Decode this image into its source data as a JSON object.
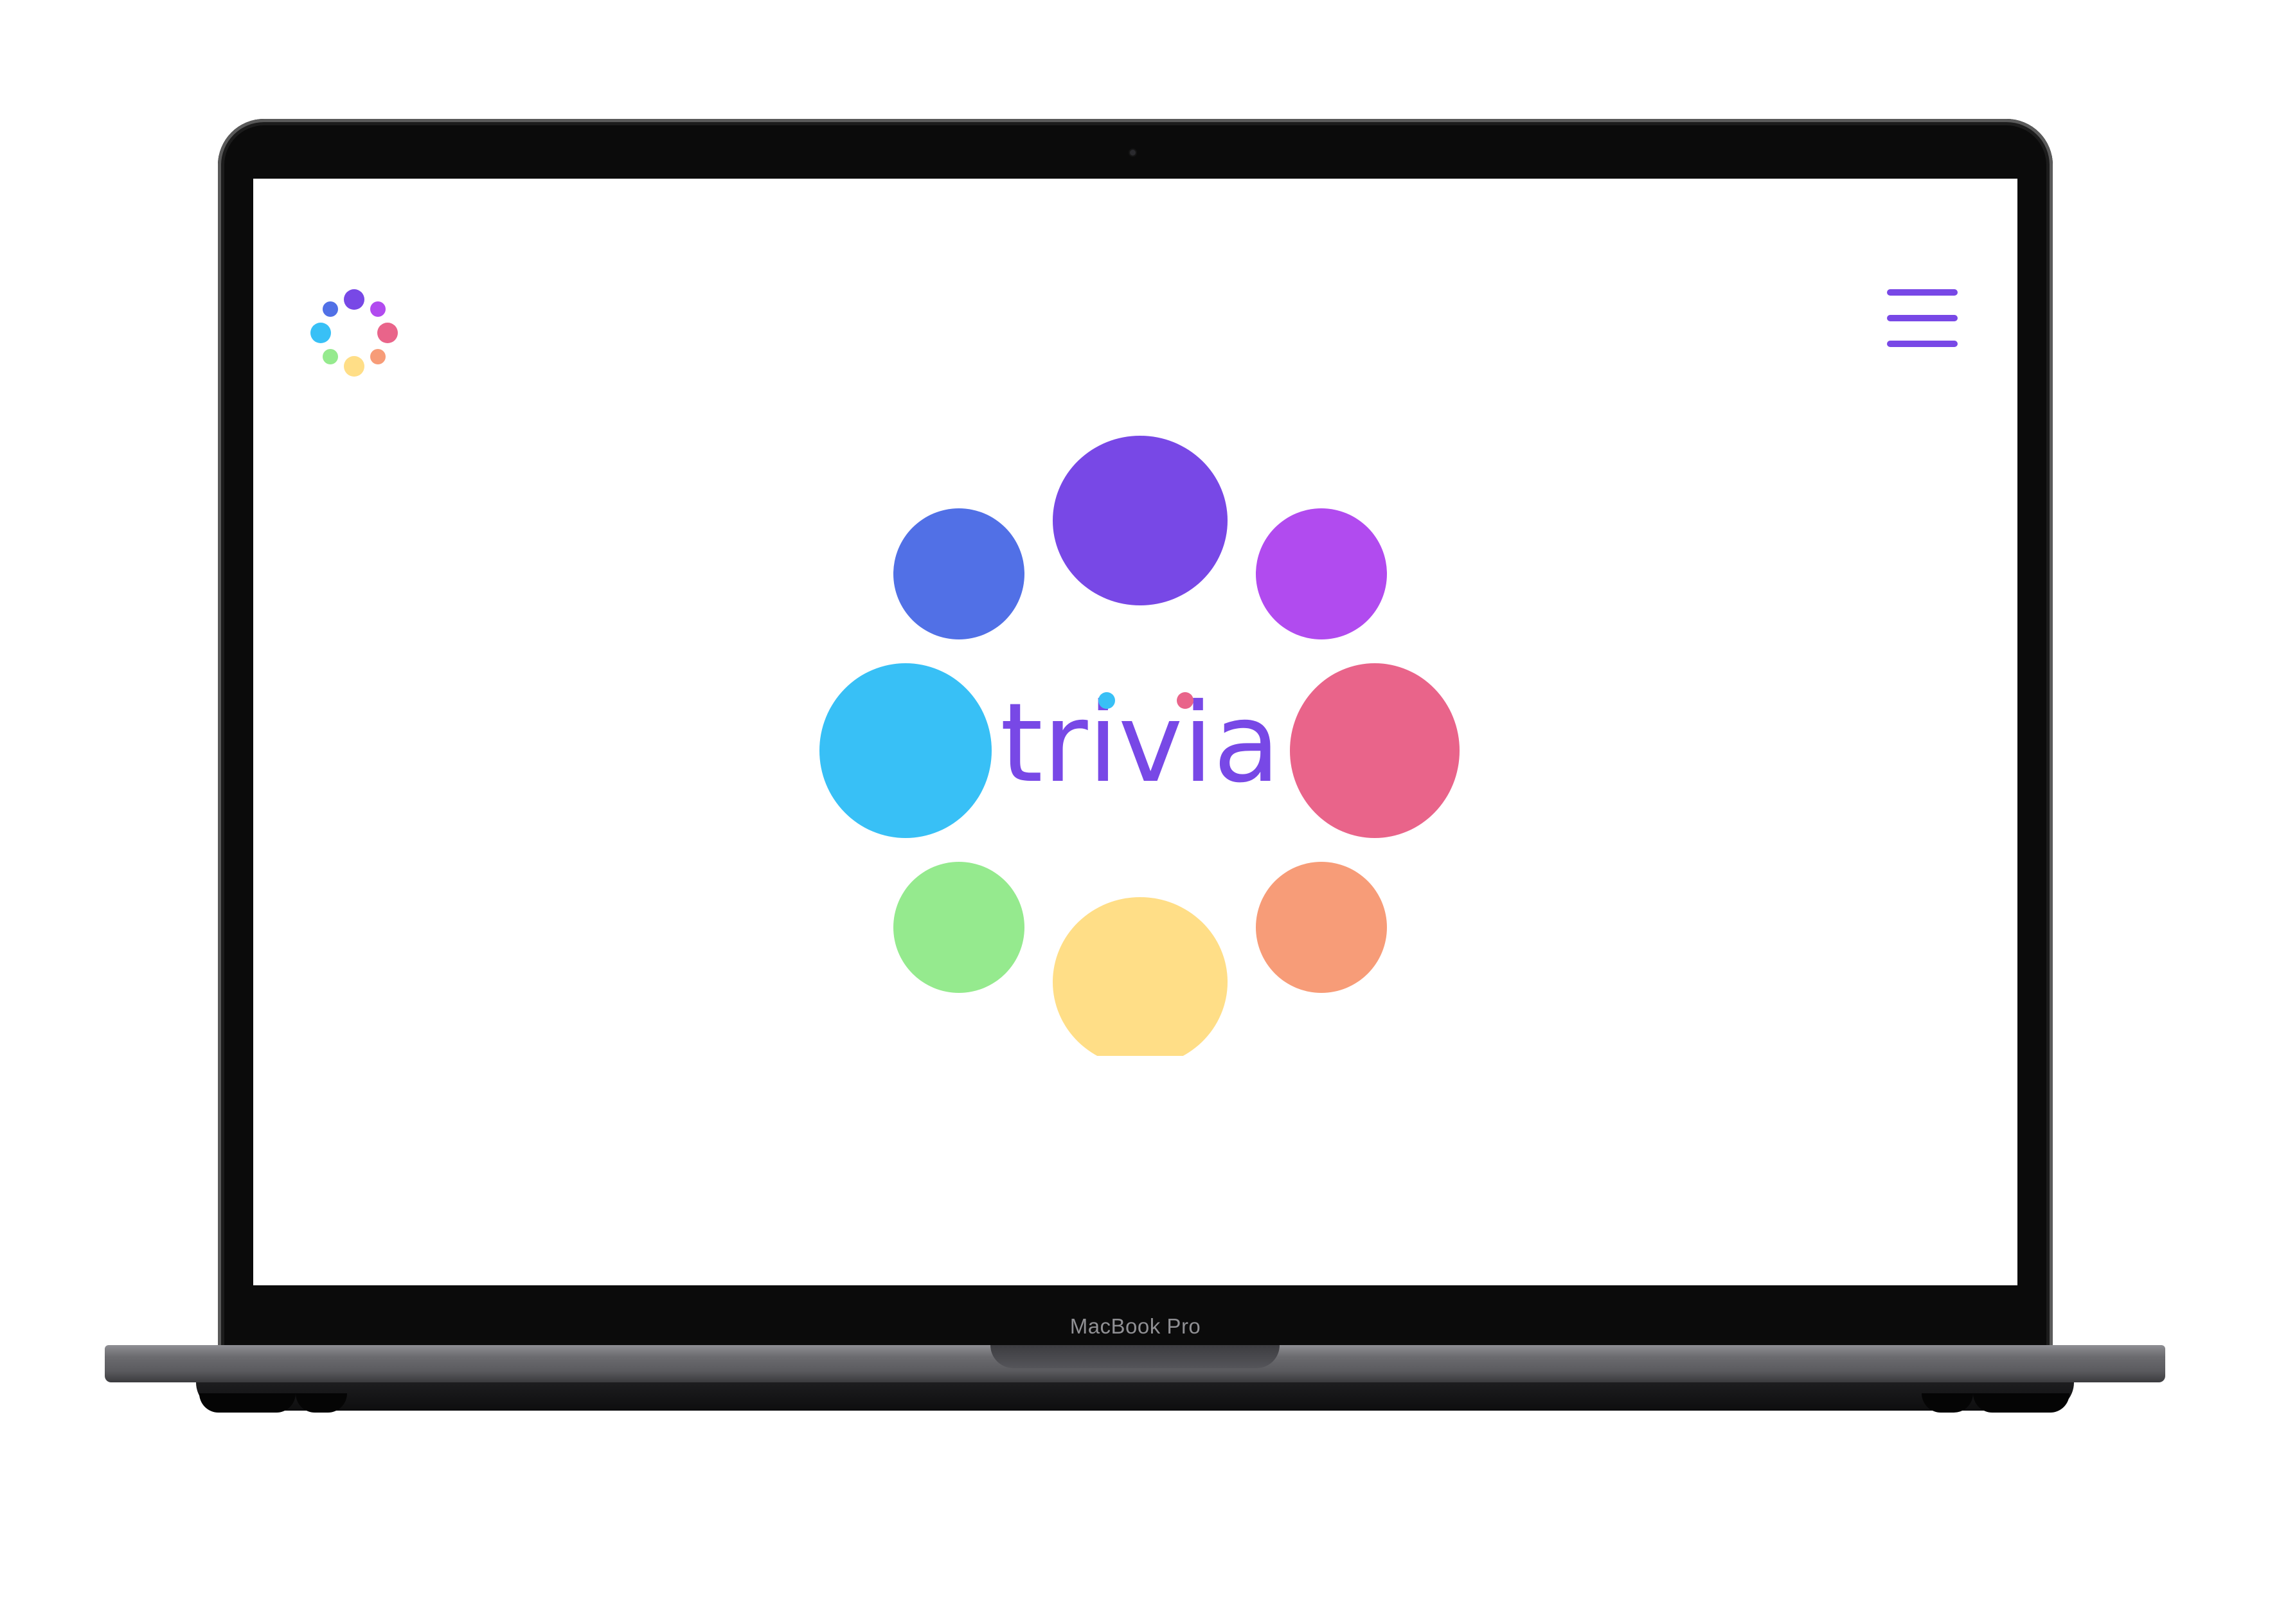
{
  "device": {
    "label": "MacBook Pro"
  },
  "app": {
    "wordmark": "trivia",
    "colors": {
      "purple": "#7848E6",
      "blue": "#5170E6",
      "violet": "#B14BEF",
      "cyan": "#38C0F6",
      "pink": "#E9648A",
      "green": "#95EA8E",
      "yellow": "#FFDE87",
      "orange": "#F79C78"
    },
    "icons": {
      "logo": "trivia-logo-icon",
      "menu": "hamburger-menu-icon"
    }
  }
}
